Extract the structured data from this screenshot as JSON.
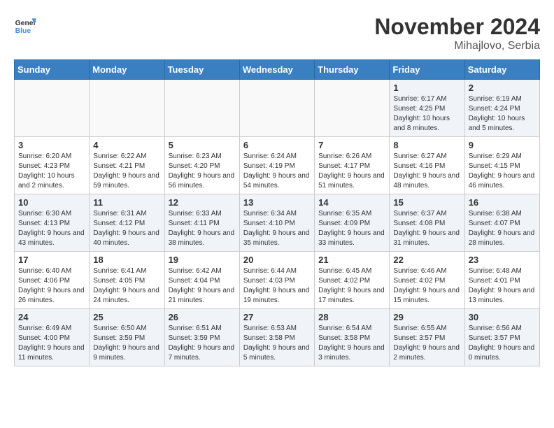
{
  "header": {
    "logo_line1": "General",
    "logo_line2": "Blue",
    "month": "November 2024",
    "location": "Mihajlovo, Serbia"
  },
  "weekdays": [
    "Sunday",
    "Monday",
    "Tuesday",
    "Wednesday",
    "Thursday",
    "Friday",
    "Saturday"
  ],
  "weeks": [
    [
      {
        "day": "",
        "info": ""
      },
      {
        "day": "",
        "info": ""
      },
      {
        "day": "",
        "info": ""
      },
      {
        "day": "",
        "info": ""
      },
      {
        "day": "",
        "info": ""
      },
      {
        "day": "1",
        "info": "Sunrise: 6:17 AM\nSunset: 4:25 PM\nDaylight: 10 hours and 8 minutes."
      },
      {
        "day": "2",
        "info": "Sunrise: 6:19 AM\nSunset: 4:24 PM\nDaylight: 10 hours and 5 minutes."
      }
    ],
    [
      {
        "day": "3",
        "info": "Sunrise: 6:20 AM\nSunset: 4:23 PM\nDaylight: 10 hours and 2 minutes."
      },
      {
        "day": "4",
        "info": "Sunrise: 6:22 AM\nSunset: 4:21 PM\nDaylight: 9 hours and 59 minutes."
      },
      {
        "day": "5",
        "info": "Sunrise: 6:23 AM\nSunset: 4:20 PM\nDaylight: 9 hours and 56 minutes."
      },
      {
        "day": "6",
        "info": "Sunrise: 6:24 AM\nSunset: 4:19 PM\nDaylight: 9 hours and 54 minutes."
      },
      {
        "day": "7",
        "info": "Sunrise: 6:26 AM\nSunset: 4:17 PM\nDaylight: 9 hours and 51 minutes."
      },
      {
        "day": "8",
        "info": "Sunrise: 6:27 AM\nSunset: 4:16 PM\nDaylight: 9 hours and 48 minutes."
      },
      {
        "day": "9",
        "info": "Sunrise: 6:29 AM\nSunset: 4:15 PM\nDaylight: 9 hours and 46 minutes."
      }
    ],
    [
      {
        "day": "10",
        "info": "Sunrise: 6:30 AM\nSunset: 4:13 PM\nDaylight: 9 hours and 43 minutes."
      },
      {
        "day": "11",
        "info": "Sunrise: 6:31 AM\nSunset: 4:12 PM\nDaylight: 9 hours and 40 minutes."
      },
      {
        "day": "12",
        "info": "Sunrise: 6:33 AM\nSunset: 4:11 PM\nDaylight: 9 hours and 38 minutes."
      },
      {
        "day": "13",
        "info": "Sunrise: 6:34 AM\nSunset: 4:10 PM\nDaylight: 9 hours and 35 minutes."
      },
      {
        "day": "14",
        "info": "Sunrise: 6:35 AM\nSunset: 4:09 PM\nDaylight: 9 hours and 33 minutes."
      },
      {
        "day": "15",
        "info": "Sunrise: 6:37 AM\nSunset: 4:08 PM\nDaylight: 9 hours and 31 minutes."
      },
      {
        "day": "16",
        "info": "Sunrise: 6:38 AM\nSunset: 4:07 PM\nDaylight: 9 hours and 28 minutes."
      }
    ],
    [
      {
        "day": "17",
        "info": "Sunrise: 6:40 AM\nSunset: 4:06 PM\nDaylight: 9 hours and 26 minutes."
      },
      {
        "day": "18",
        "info": "Sunrise: 6:41 AM\nSunset: 4:05 PM\nDaylight: 9 hours and 24 minutes."
      },
      {
        "day": "19",
        "info": "Sunrise: 6:42 AM\nSunset: 4:04 PM\nDaylight: 9 hours and 21 minutes."
      },
      {
        "day": "20",
        "info": "Sunrise: 6:44 AM\nSunset: 4:03 PM\nDaylight: 9 hours and 19 minutes."
      },
      {
        "day": "21",
        "info": "Sunrise: 6:45 AM\nSunset: 4:02 PM\nDaylight: 9 hours and 17 minutes."
      },
      {
        "day": "22",
        "info": "Sunrise: 6:46 AM\nSunset: 4:02 PM\nDaylight: 9 hours and 15 minutes."
      },
      {
        "day": "23",
        "info": "Sunrise: 6:48 AM\nSunset: 4:01 PM\nDaylight: 9 hours and 13 minutes."
      }
    ],
    [
      {
        "day": "24",
        "info": "Sunrise: 6:49 AM\nSunset: 4:00 PM\nDaylight: 9 hours and 11 minutes."
      },
      {
        "day": "25",
        "info": "Sunrise: 6:50 AM\nSunset: 3:59 PM\nDaylight: 9 hours and 9 minutes."
      },
      {
        "day": "26",
        "info": "Sunrise: 6:51 AM\nSunset: 3:59 PM\nDaylight: 9 hours and 7 minutes."
      },
      {
        "day": "27",
        "info": "Sunrise: 6:53 AM\nSunset: 3:58 PM\nDaylight: 9 hours and 5 minutes."
      },
      {
        "day": "28",
        "info": "Sunrise: 6:54 AM\nSunset: 3:58 PM\nDaylight: 9 hours and 3 minutes."
      },
      {
        "day": "29",
        "info": "Sunrise: 6:55 AM\nSunset: 3:57 PM\nDaylight: 9 hours and 2 minutes."
      },
      {
        "day": "30",
        "info": "Sunrise: 6:56 AM\nSunset: 3:57 PM\nDaylight: 9 hours and 0 minutes."
      }
    ]
  ]
}
